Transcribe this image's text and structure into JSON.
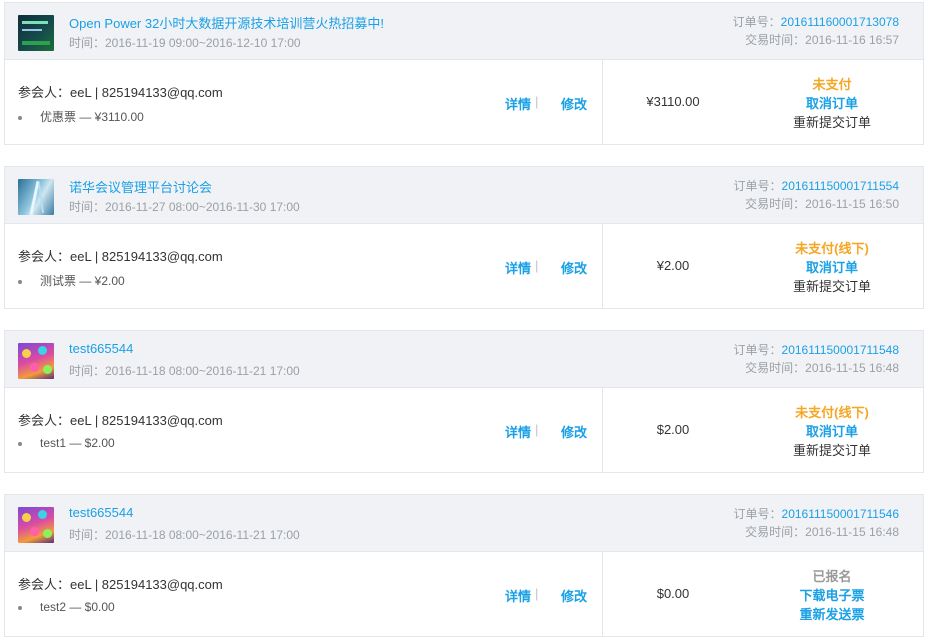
{
  "orders": [
    {
      "title": "Open Power 32小时大数据开源技术培训营火热招募中!",
      "time": "时间：2016-11-19 09:00~2016-12-10 17:00",
      "order_no_label": "订单号：",
      "order_no": "201611160001713078",
      "trade_time": "交易时间：2016-11-16 16:57",
      "attendee": "参会人：eeL | 825194133@qq.com",
      "ticket": "优惠票 — ¥3110.00",
      "detail": "详情",
      "sep": "|",
      "edit": "修改",
      "price": "¥3110.00",
      "status": "未支付",
      "action1": "取消订单",
      "action2": "重新提交订单"
    },
    {
      "title": "诺华会议管理平台讨论会",
      "time": "时间：2016-11-27 08:00~2016-11-30 17:00",
      "order_no_label": "订单号：",
      "order_no": "201611150001711554",
      "trade_time": "交易时间：2016-11-15 16:50",
      "attendee": "参会人：eeL | 825194133@qq.com",
      "ticket": "测试票 — ¥2.00",
      "detail": "详情",
      "sep": "|",
      "edit": "修改",
      "price": "¥2.00",
      "status": "未支付(线下)",
      "action1": "取消订单",
      "action2": "重新提交订单"
    },
    {
      "title": "test665544",
      "time": "时间：2016-11-18 08:00~2016-11-21 17:00",
      "order_no_label": "订单号：",
      "order_no": "201611150001711548",
      "trade_time": "交易时间：2016-11-15 16:48",
      "attendee": "参会人：eeL | 825194133@qq.com",
      "ticket": "test1 — $2.00",
      "detail": "详情",
      "sep": "|",
      "edit": "修改",
      "price": "$2.00",
      "status": "未支付(线下)",
      "action1": "取消订单",
      "action2": "重新提交订单"
    },
    {
      "title": "test665544",
      "time": "时间：2016-11-18 08:00~2016-11-21 17:00",
      "order_no_label": "订单号：",
      "order_no": "201611150001711546",
      "trade_time": "交易时间：2016-11-15 16:48",
      "attendee": "参会人：eeL | 825194133@qq.com",
      "ticket": "test2 — $0.00",
      "detail": "详情",
      "sep": "|",
      "edit": "修改",
      "price": "$0.00",
      "status": "已报名",
      "action1": "下载电子票",
      "action2": "重新发送票"
    }
  ],
  "colors": {
    "link": "#1aa0e6",
    "pending": "#f5a623",
    "header_bg": "#f1f2f5",
    "muted": "#9aa0a6"
  },
  "icons": [
    "bullet-icon"
  ]
}
